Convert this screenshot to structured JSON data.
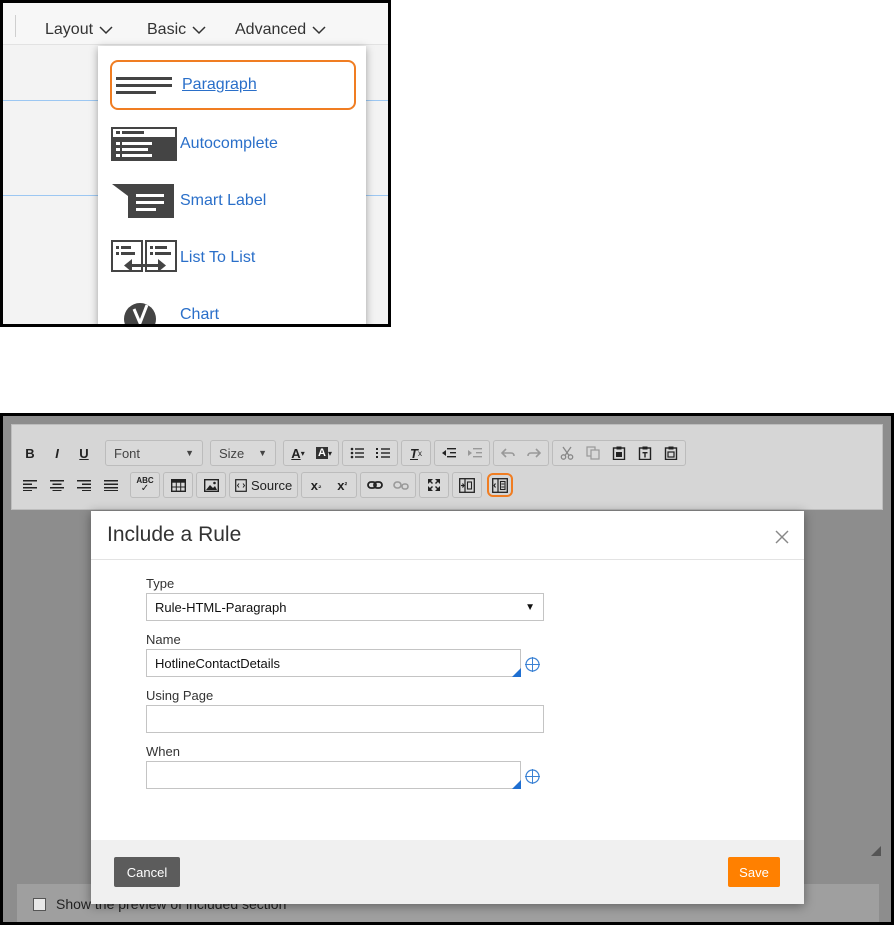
{
  "menubar": {
    "tabs": [
      {
        "label": "Layout",
        "icon": "chevron-down-icon"
      },
      {
        "label": "Basic",
        "icon": "chevron-down-icon"
      },
      {
        "label": "Advanced",
        "icon": "chevron-down-icon"
      }
    ]
  },
  "dropdown": {
    "items": [
      {
        "label": "Paragraph",
        "icon": "paragraph-icon",
        "highlighted": true
      },
      {
        "label": "Autocomplete",
        "icon": "autocomplete-icon"
      },
      {
        "label": "Smart Label",
        "icon": "smart-label-icon"
      },
      {
        "label": "List To List",
        "icon": "list-to-list-icon"
      },
      {
        "label": "Chart",
        "icon": "chart-icon"
      }
    ],
    "highlight_color": "#f07d22",
    "link_color": "#2a6fc9"
  },
  "toolbar": {
    "bold": "B",
    "italic": "I",
    "underline": "U",
    "font_label": "Font",
    "size_label": "Size",
    "source_label": "Source",
    "spell_label": "ABC"
  },
  "modal": {
    "title": "Include a Rule",
    "type_label": "Type",
    "type_value": "Rule-HTML-Paragraph",
    "name_label": "Name",
    "name_value": "HotlineContactDetails",
    "using_page_label": "Using Page",
    "using_page_value": "",
    "when_label": "When",
    "when_value": "",
    "cancel_label": "Cancel",
    "save_label": "Save",
    "save_color": "#ff8000"
  },
  "preview": {
    "label": "Show the preview of included section"
  }
}
